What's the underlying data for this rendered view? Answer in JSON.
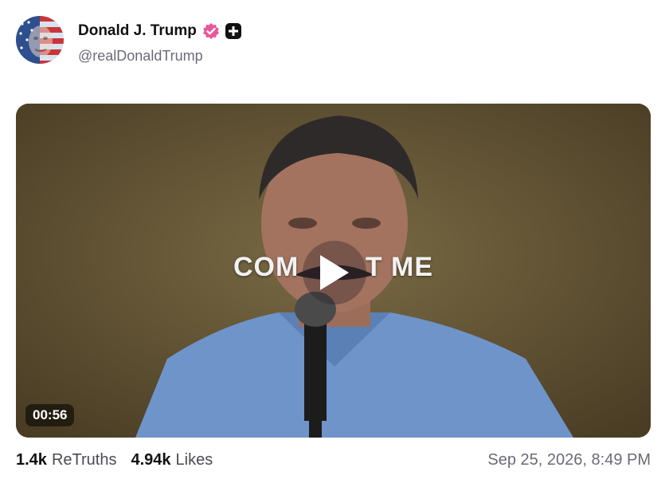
{
  "author": {
    "display_name": "Donald J. Trump",
    "handle": "@realDonaldTrump",
    "verified_badge_color": "#e8579b",
    "avatar_icon": "flag-face-avatar"
  },
  "video": {
    "caption_text": "COM        T ME",
    "duration": "00:56",
    "play_icon": "play-icon"
  },
  "stats": {
    "retruths_count": "1.4k",
    "retruths_label": "ReTruths",
    "likes_count": "4.94k",
    "likes_label": "Likes"
  },
  "timestamp": "Sep 25, 2026, 8:49 PM"
}
